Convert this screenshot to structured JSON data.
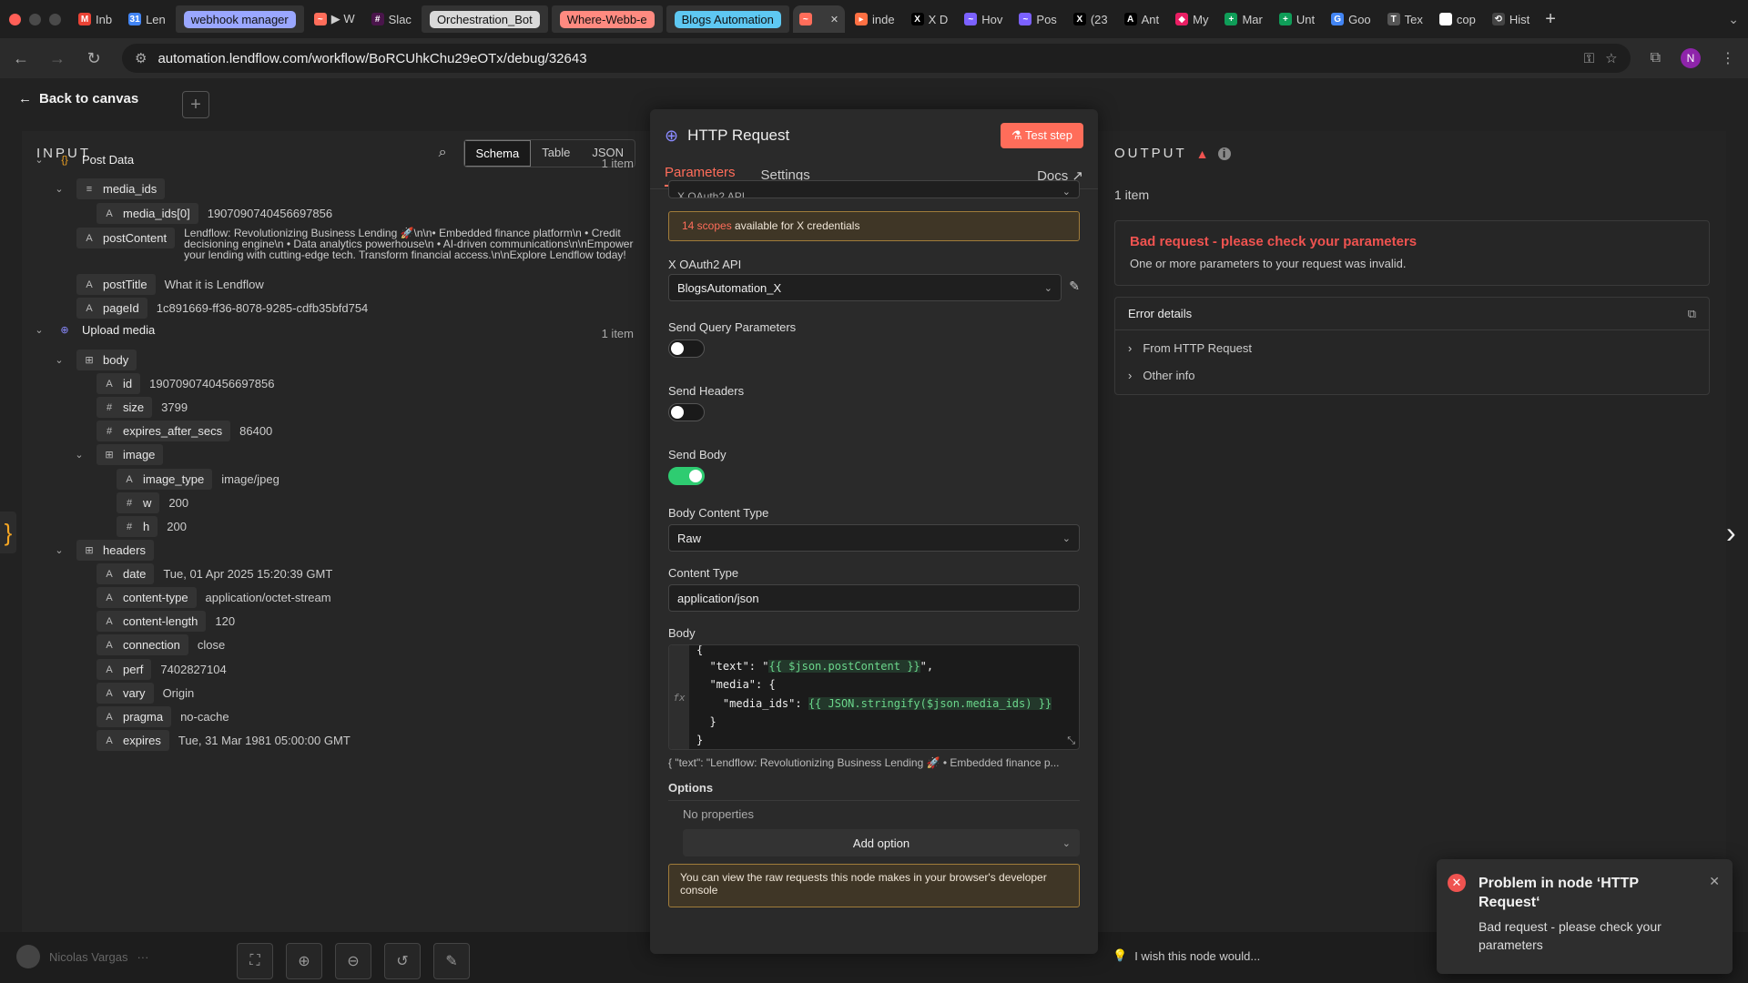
{
  "browser": {
    "tabs": [
      {
        "label": "Inb",
        "icon": "gmail-icon",
        "color": "#ea4335",
        "fav": "M"
      },
      {
        "label": "Len",
        "icon": "calendar-icon",
        "color": "#4285f4",
        "fav": "31"
      },
      {
        "label": "webhook manager",
        "pill": "#9aa7ff"
      },
      {
        "label": "▶ W",
        "icon": "n8n-icon",
        "color": "#ff6d5a",
        "fav": "~"
      },
      {
        "label": "Slac",
        "icon": "slack-icon",
        "color": "#4a154b",
        "fav": "#"
      },
      {
        "label": "Orchestration_Bot",
        "pill": "#d9d9d9"
      },
      {
        "label": "Where-Webb-e",
        "pill": "#ff8a80"
      },
      {
        "label": "Blogs Automation",
        "pill": "#5ec8f2"
      },
      {
        "label": "",
        "icon": "n8n-icon",
        "color": "#ff6d5a",
        "fav": "~",
        "active": true
      },
      {
        "label": "inde",
        "icon": "bookmark-icon",
        "color": "#ff7043",
        "fav": "▸"
      },
      {
        "label": "X D",
        "icon": "x-icon",
        "color": "#000",
        "fav": "X"
      },
      {
        "label": "Hov",
        "icon": "doc-icon",
        "color": "#7b61ff",
        "fav": "~"
      },
      {
        "label": "Pos",
        "icon": "doc-icon",
        "color": "#7b61ff",
        "fav": "~"
      },
      {
        "label": "(23",
        "icon": "x-icon",
        "color": "#000",
        "fav": "X"
      },
      {
        "label": "Ant",
        "icon": "anthropic-icon",
        "color": "#000",
        "fav": "A"
      },
      {
        "label": "My",
        "icon": "app-icon",
        "color": "#e91e63",
        "fav": "◆"
      },
      {
        "label": "Mar",
        "icon": "sheets-icon",
        "color": "#0f9d58",
        "fav": "+"
      },
      {
        "label": "Unt",
        "icon": "sheets-icon",
        "color": "#0f9d58",
        "fav": "+"
      },
      {
        "label": "Goo",
        "icon": "translate-icon",
        "color": "#4285f4",
        "fav": "G"
      },
      {
        "label": "Tex",
        "icon": "text-icon",
        "color": "#555",
        "fav": "T"
      },
      {
        "label": "cop",
        "icon": "google-icon",
        "color": "#fff",
        "fav": "G"
      },
      {
        "label": "Hist",
        "icon": "history-icon",
        "color": "#444",
        "fav": "⟲"
      }
    ],
    "url": "automation.lendflow.com/workflow/BoRCUhkChu29eOTx/debug/32643",
    "profile": "N"
  },
  "nav": {
    "back": "Back to canvas"
  },
  "input": {
    "title": "INPUT",
    "views": [
      "Schema",
      "Table",
      "JSON"
    ],
    "rows": [
      {
        "lvl": 0,
        "chev": "v",
        "type": "{}",
        "key": "Post Data",
        "nobox": true,
        "count": "1 item"
      },
      {
        "lvl": 1,
        "chev": "v",
        "type": "≡",
        "key": "media_ids"
      },
      {
        "lvl": 2,
        "type": "A",
        "key": "media_ids[0]",
        "val": "1907090740456697856"
      },
      {
        "lvl": 1,
        "type": "A",
        "key": "postContent",
        "val": "Lendflow: Revolutionizing Business Lending 🚀\\n\\n• Embedded finance platform\\n • Credit decisioning engine\\n • Data analytics powerhouse\\n • AI-driven communications\\n\\nEmpower your lending with cutting-edge tech. Transform financial access.\\n\\nExplore Lendflow today!",
        "tall": true
      },
      {
        "lvl": 1,
        "type": "A",
        "key": "postTitle",
        "val": "What it is Lendflow"
      },
      {
        "lvl": 1,
        "type": "A",
        "key": "pageId",
        "val": "1c891669-ff36-8078-9285-cdfb35bfd754"
      },
      {
        "lvl": 0,
        "chev": "v",
        "type": "⊕",
        "key": "Upload media",
        "nobox": true,
        "count": "1 item"
      },
      {
        "lvl": 1,
        "chev": "v",
        "type": "⊞",
        "key": "body"
      },
      {
        "lvl": 2,
        "type": "A",
        "key": "id",
        "val": "1907090740456697856"
      },
      {
        "lvl": 2,
        "type": "#",
        "key": "size",
        "val": "3799"
      },
      {
        "lvl": 2,
        "type": "#",
        "key": "expires_after_secs",
        "val": "86400"
      },
      {
        "lvl": 2,
        "chev": "v",
        "type": "⊞",
        "key": "image"
      },
      {
        "lvl": 3,
        "type": "A",
        "key": "image_type",
        "val": "image/jpeg"
      },
      {
        "lvl": 3,
        "type": "#",
        "key": "w",
        "val": "200"
      },
      {
        "lvl": 3,
        "type": "#",
        "key": "h",
        "val": "200"
      },
      {
        "lvl": 1,
        "chev": "v",
        "type": "⊞",
        "key": "headers"
      },
      {
        "lvl": 2,
        "type": "A",
        "key": "date",
        "val": "Tue, 01 Apr 2025 15:20:39 GMT"
      },
      {
        "lvl": 2,
        "type": "A",
        "key": "content-type",
        "val": "application/octet-stream"
      },
      {
        "lvl": 2,
        "type": "A",
        "key": "content-length",
        "val": "120"
      },
      {
        "lvl": 2,
        "type": "A",
        "key": "connection",
        "val": "close"
      },
      {
        "lvl": 2,
        "type": "A",
        "key": "perf",
        "val": "7402827104"
      },
      {
        "lvl": 2,
        "type": "A",
        "key": "vary",
        "val": "Origin"
      },
      {
        "lvl": 2,
        "type": "A",
        "key": "pragma",
        "val": "no-cache"
      },
      {
        "lvl": 2,
        "type": "A",
        "key": "expires",
        "val": "Tue, 31 Mar 1981 05:00:00 GMT"
      }
    ]
  },
  "node": {
    "title": "HTTP Request",
    "test_btn": "Test step",
    "tabs": {
      "parameters": "Parameters",
      "settings": "Settings",
      "docs": "Docs"
    },
    "cut_select": "X OAuth2 API",
    "scopes_count": "14 scopes",
    "scopes_text": " available for X credentials",
    "cred_label": "X OAuth2 API",
    "cred_value": "BlogsAutomation_X",
    "query_label": "Send Query Parameters",
    "query_on": false,
    "headers_label": "Send Headers",
    "headers_on": false,
    "body_label": "Send Body",
    "body_on": true,
    "content_type_label": "Body Content Type",
    "content_type_value": "Raw",
    "ctype_label": "Content Type",
    "ctype_value": "application/json",
    "body_field_label": "Body",
    "code": {
      "l0": "{",
      "l1a": "  \"text\": \"",
      "l1b": "{{ $json.postContent }}",
      "l1c": "\",",
      "l2": "  \"media\": {",
      "l3a": "    \"media_ids\": ",
      "l3b": "{{ JSON.stringify($json.media_ids) }}",
      "l4": "  }",
      "l5": "}"
    },
    "preview": "{  \"text\": \"Lendflow: Revolutionizing Business Lending 🚀 • Embedded finance p...",
    "options_label": "Options",
    "no_props": "No properties",
    "add_option": "Add option",
    "notice": "You can view the raw requests this node makes in your browser's developer console"
  },
  "output": {
    "title": "OUTPUT",
    "items": "1 item",
    "err_title": "Bad request - please check your parameters",
    "err_sub": "One or more parameters to your request was invalid.",
    "details_title": "Error details",
    "detail1": "From HTTP Request",
    "detail2": "Other info"
  },
  "footer": {
    "user": "Nicolas Vargas",
    "wish": "I wish this node would..."
  },
  "toast": {
    "title": "Problem in node ‘HTTP Request‘",
    "body": "Bad request - please check your parameters"
  },
  "colors": {
    "accent": "#ff6d5a",
    "success": "#2ecc71",
    "error": "#ef5350"
  }
}
